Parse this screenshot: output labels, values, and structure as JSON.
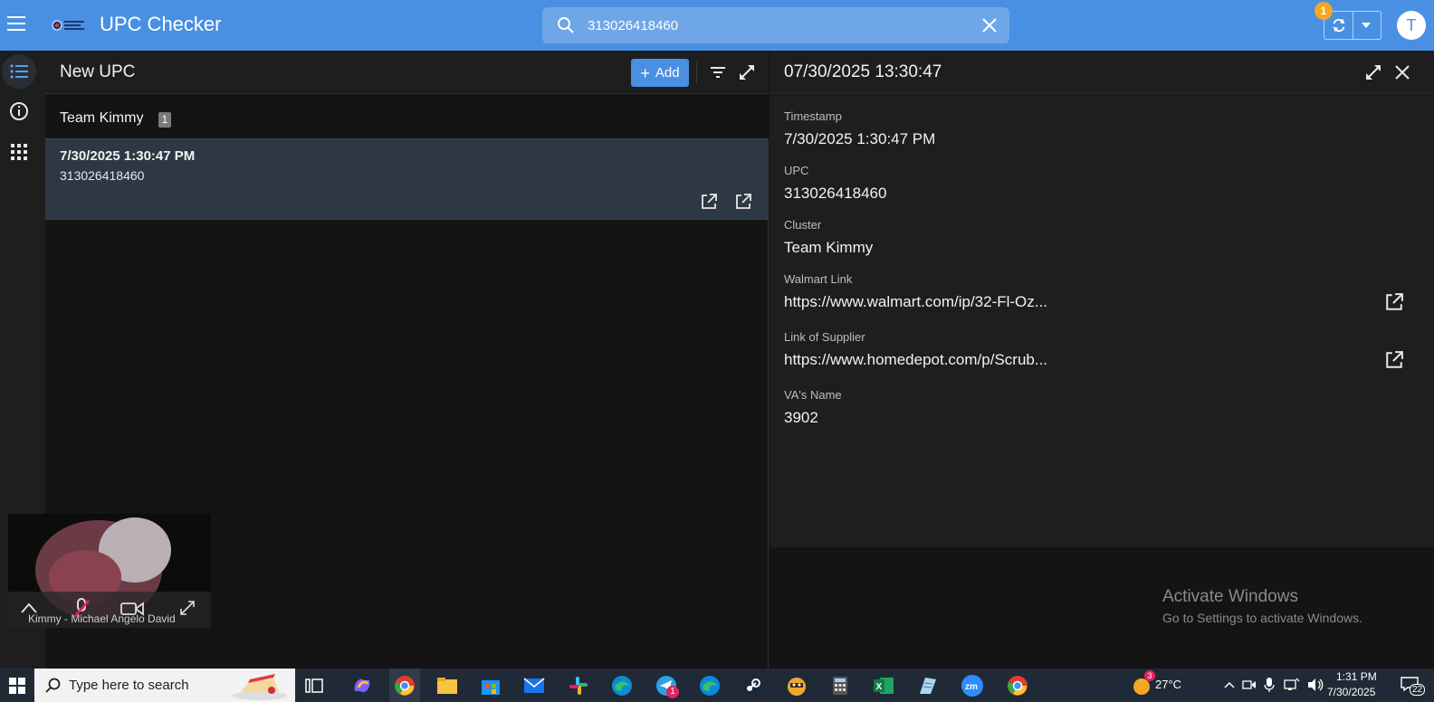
{
  "header": {
    "app_title": "UPC Checker",
    "search_value": "313026418460",
    "sync_badge_count": "1",
    "avatar_initial": "T"
  },
  "list_panel": {
    "title": "New UPC",
    "add_label": "Add",
    "group_label": "Team Kimmy",
    "group_count": "1",
    "records": [
      {
        "timestamp": "7/30/2025 1:30:47 PM",
        "upc": "313026418460"
      }
    ]
  },
  "detail": {
    "title": "07/30/2025 13:30:47",
    "fields": {
      "timestamp_label": "Timestamp",
      "timestamp_value": "7/30/2025 1:30:47 PM",
      "upc_label": "UPC",
      "upc_value": "313026418460",
      "cluster_label": "Cluster",
      "cluster_value": "Team Kimmy",
      "walmart_label": "Walmart Link",
      "walmart_value": "https://www.walmart.com/ip/32-Fl-Oz...",
      "supplier_label": "Link of Supplier",
      "supplier_value": "https://www.homedepot.com/p/Scrub...",
      "va_label": "VA's Name",
      "va_value": "3902"
    }
  },
  "watermark": {
    "title": "Activate Windows",
    "subtitle": "Go to Settings to activate Windows."
  },
  "video_overlay": {
    "participant": "Kimmy - Michael Angelo David"
  },
  "taskbar": {
    "search_placeholder": "Type here to search",
    "weather": "27°C",
    "weather_badge": "3",
    "time": "1:31 PM",
    "date": "7/30/2025",
    "notification_count": "22",
    "telegram_badge": "1"
  },
  "colors": {
    "topbar": "#4a90e2",
    "accent": "#4a90e2",
    "panel": "#1e1e1e",
    "background": "#141414",
    "selected_row": "#2d3844",
    "badge": "#f5a623"
  }
}
